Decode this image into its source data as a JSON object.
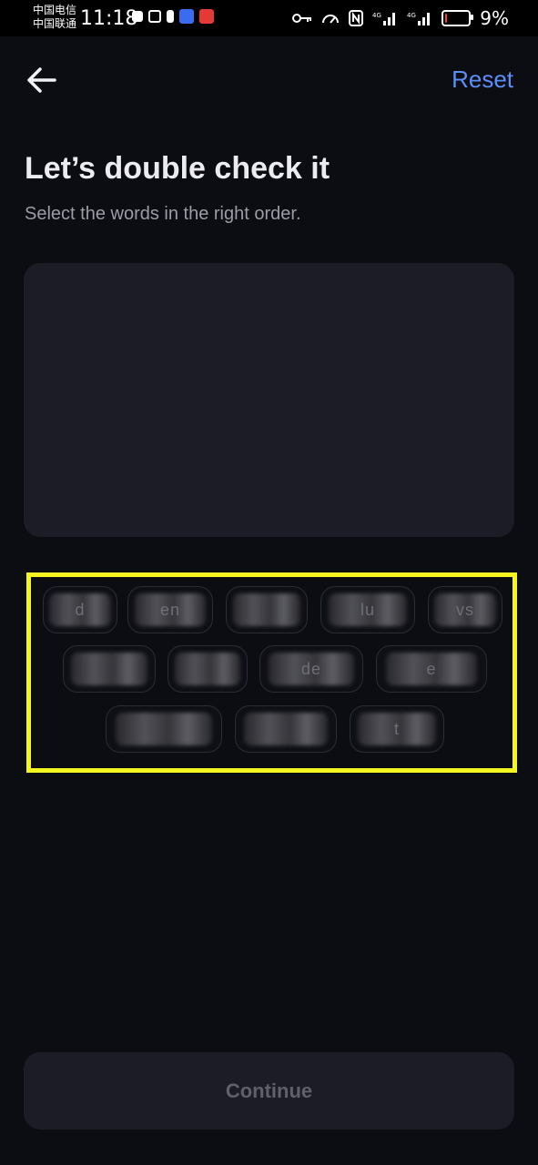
{
  "status_bar": {
    "carrier_1": "中国电信",
    "carrier_2": "中国联通",
    "time": "11:18",
    "battery_percent": "9%",
    "battery_level": 0.09
  },
  "header": {
    "back_icon": "arrow-left-icon",
    "reset_label": "Reset"
  },
  "page": {
    "title": "Let’s double check it",
    "subtitle": "Select the words in the right order."
  },
  "word_chips": [
    {
      "text": "d"
    },
    {
      "text": "en"
    },
    {
      "text": ""
    },
    {
      "text": "lu"
    },
    {
      "text": "vs"
    },
    {
      "text": ""
    },
    {
      "text": ""
    },
    {
      "text": "de"
    },
    {
      "text": "e"
    },
    {
      "text": ""
    },
    {
      "text": ""
    },
    {
      "text": "t"
    }
  ],
  "footer": {
    "continue_label": "Continue"
  },
  "colors": {
    "accent": "#5b8ef7",
    "highlight": "#f5f51f",
    "background": "#0c0d12"
  }
}
